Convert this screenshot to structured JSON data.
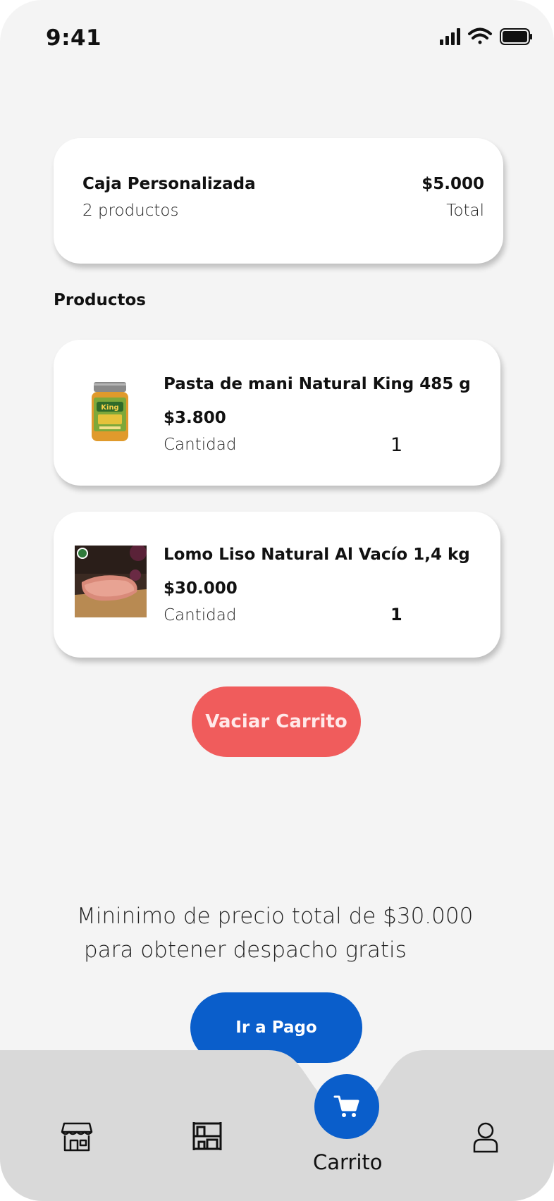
{
  "status_bar": {
    "time": "9:41"
  },
  "summary": {
    "title": "Caja Personalizada",
    "count": "2 productos",
    "price": "$5.000",
    "price_label": "Total"
  },
  "section_title": "Productos",
  "products": [
    {
      "name": "Pasta de mani Natural King 485 g",
      "price": "$3.800",
      "qty_label": "Cantidad",
      "qty": "1"
    },
    {
      "name": "Lomo Liso Natural Al Vacío 1,4 kg",
      "price": "$30.000",
      "qty_label": "Cantidad",
      "qty": "1"
    }
  ],
  "empty_button": "Vaciar Carrito",
  "notice": {
    "line1": "Mininimo de precio total de $30.000",
    "line2": "para obtener despacho gratis"
  },
  "pay_button": "Ir a Pago",
  "nav": {
    "cart_label": "Carrito",
    "icons": [
      "store-icon",
      "catalog-icon",
      "cart-icon",
      "user-icon"
    ]
  },
  "colors": {
    "background": "#f4f4f4",
    "accent_blue": "#0a5ecb",
    "danger_red": "#f05c5c",
    "nav_bg": "#d9d9d9"
  }
}
